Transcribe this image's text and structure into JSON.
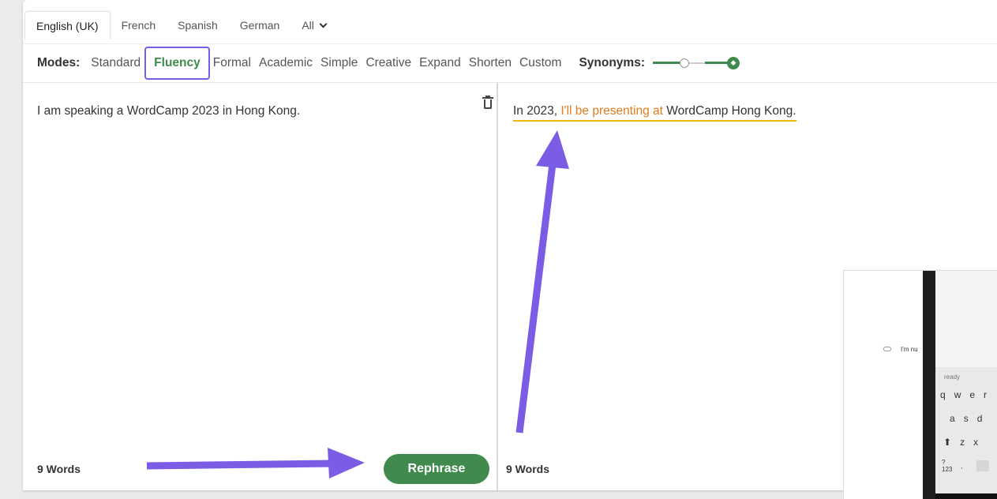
{
  "language_tabs": [
    {
      "label": "English (UK)",
      "active": true
    },
    {
      "label": "French",
      "active": false
    },
    {
      "label": "Spanish",
      "active": false
    },
    {
      "label": "German",
      "active": false
    },
    {
      "label": "All",
      "active": false
    }
  ],
  "modes": {
    "label": "Modes:",
    "items": [
      "Standard",
      "Fluency",
      "Formal",
      "Academic",
      "Simple",
      "Creative",
      "Expand",
      "Shorten",
      "Custom"
    ],
    "active": "Fluency"
  },
  "synonyms": {
    "label": "Synonyms:"
  },
  "input": {
    "text": "I am speaking a WordCamp 2023 in Hong Kong.",
    "word_count": "9 Words"
  },
  "output": {
    "part1": "In 2023, ",
    "changed": "I'll be presenting at",
    "part2": " WordCamp Hong Kong.",
    "word_count": "9 Words"
  },
  "rephrase_label": "Rephrase",
  "phone": {
    "chat_text": "I'm nu",
    "suggestion": "ready",
    "row1": [
      "q",
      "w",
      "e",
      "r"
    ],
    "row2": [
      "a",
      "s",
      "d"
    ],
    "row3": [
      "z",
      "x"
    ],
    "row4_key": "?123",
    "row4_comma": ","
  },
  "colors": {
    "accent_green": "#3f8a4c",
    "highlight_purple": "#7b5ce5",
    "changed_orange": "#e07b1e",
    "underline_yellow": "#f2b500"
  }
}
